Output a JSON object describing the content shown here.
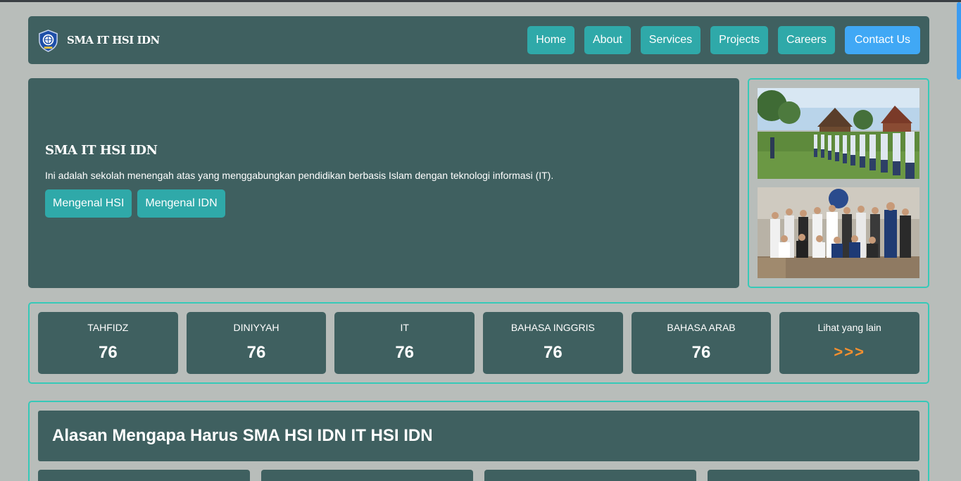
{
  "brand": {
    "name": "SMA IT HSI IDN",
    "logo_icon": "school-shield-logo"
  },
  "nav": {
    "items": [
      {
        "label": "Home"
      },
      {
        "label": "About"
      },
      {
        "label": "Services"
      },
      {
        "label": "Projects"
      },
      {
        "label": "Careers"
      }
    ],
    "contact_label": "Contact Us"
  },
  "hero": {
    "title": "SMA IT HSI IDN",
    "description": "Ini adalah sekolah menengah atas yang menggabungkan pendidikan berbasis Islam dengan teknologi informasi (IT).",
    "buttons": [
      {
        "label": "Mengenal HSI"
      },
      {
        "label": "Mengenal IDN"
      }
    ]
  },
  "stats": [
    {
      "label": "TAHFIDZ",
      "value": "76"
    },
    {
      "label": "DINIYYAH",
      "value": "76"
    },
    {
      "label": "IT",
      "value": "76"
    },
    {
      "label": "BAHASA INGGRIS",
      "value": "76"
    },
    {
      "label": "BAHASA ARAB",
      "value": "76"
    }
  ],
  "stats_more": {
    "label": "Lihat yang lain",
    "arrow": ">>>"
  },
  "reasons": {
    "title": "Alasan Mengapa Harus SMA HSI IDN IT HSI IDN"
  },
  "colors": {
    "background": "#b8bdba",
    "panel": "#3f6060",
    "teal_button": "#2fa9a9",
    "contact_button": "#40a8f5",
    "border_accent": "#36c9b8",
    "arrow_orange": "#f5902f"
  }
}
